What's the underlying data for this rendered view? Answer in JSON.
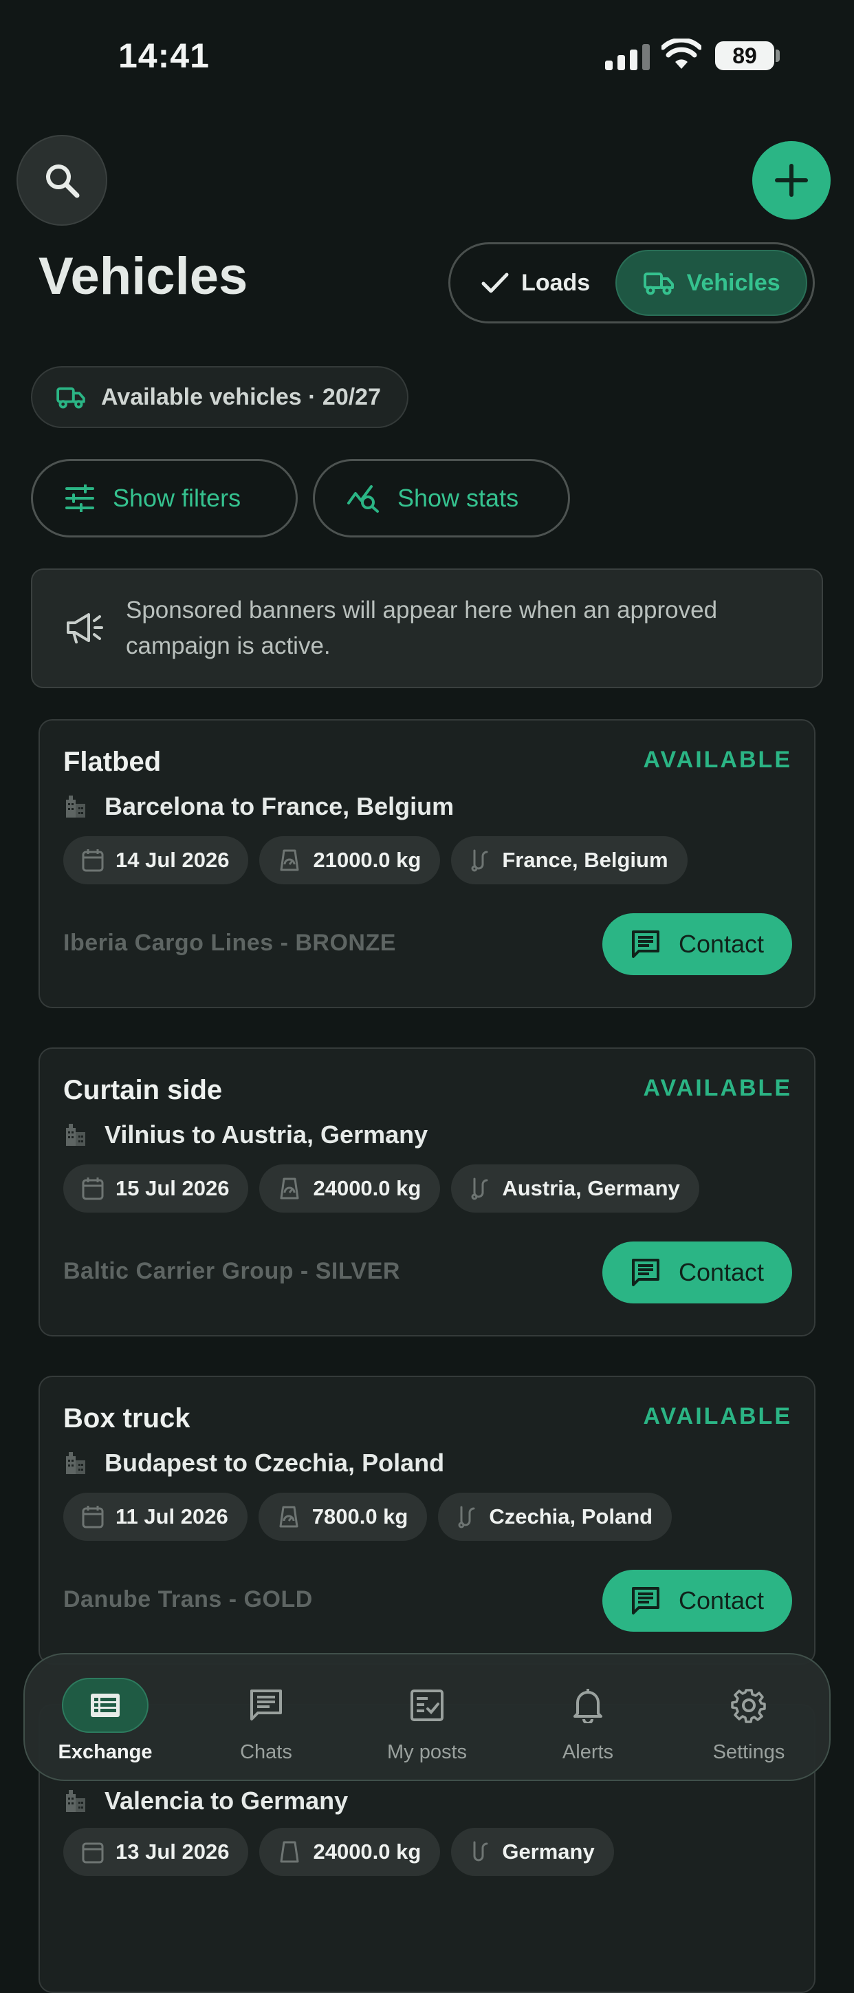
{
  "status_bar": {
    "time": "14:41",
    "battery": "89"
  },
  "header": {
    "title": "Vehicles"
  },
  "toggle": {
    "loads_label": "Loads",
    "vehicles_label": "Vehicles"
  },
  "summary": {
    "available_label": "Available vehicles · 20/27"
  },
  "actions": {
    "filters_label": "Show filters",
    "stats_label": "Show stats"
  },
  "sponsor": {
    "text": "Sponsored banners will appear here when an approved campaign is active."
  },
  "colors": {
    "accent": "#2bb585",
    "background": "#111716",
    "card": "#1b2120"
  },
  "cards": [
    {
      "type": "Flatbed",
      "status": "AVAILABLE",
      "route": "Barcelona to France, Belgium",
      "date": "14 Jul 2026",
      "weight": "21000.0 kg",
      "destinations": "France, Belgium",
      "company": "Iberia Cargo Lines - BRONZE",
      "contact_label": "Contact"
    },
    {
      "type": "Curtain side",
      "status": "AVAILABLE",
      "route": "Vilnius to Austria, Germany",
      "date": "15 Jul 2026",
      "weight": "24000.0 kg",
      "destinations": "Austria, Germany",
      "company": "Baltic Carrier Group - SILVER",
      "contact_label": "Contact"
    },
    {
      "type": "Box truck",
      "status": "AVAILABLE",
      "route": "Budapest to Czechia, Poland",
      "date": "11 Jul 2026",
      "weight": "7800.0 kg",
      "destinations": "Czechia, Poland",
      "company": "Danube Trans - GOLD",
      "contact_label": "Contact"
    },
    {
      "type": "",
      "status": "",
      "route": "Valencia to Germany",
      "date": "13 Jul 2026",
      "weight": "24000.0 kg",
      "destinations": "Germany",
      "company": "",
      "contact_label": ""
    }
  ],
  "nav": [
    {
      "label": "Exchange",
      "icon": "table-list-icon",
      "active": true
    },
    {
      "label": "Chats",
      "icon": "chat-icon",
      "active": false
    },
    {
      "label": "My posts",
      "icon": "posts-check-icon",
      "active": false
    },
    {
      "label": "Alerts",
      "icon": "bell-icon",
      "active": false
    },
    {
      "label": "Settings",
      "icon": "gear-icon",
      "active": false
    }
  ]
}
